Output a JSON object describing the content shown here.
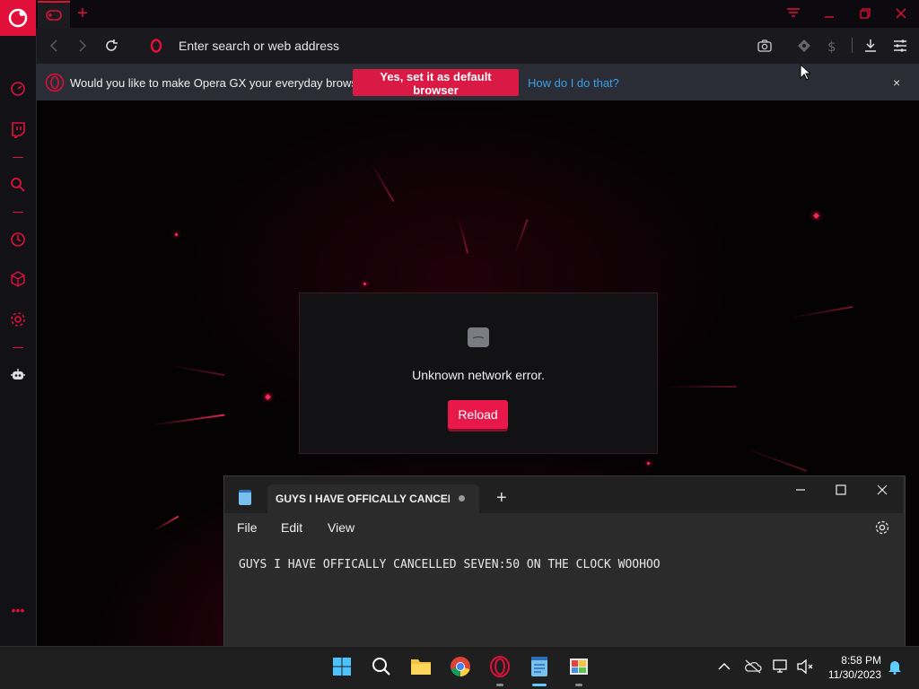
{
  "browser": {
    "address_placeholder": "Enter search or web address"
  },
  "default_bar": {
    "question": "Would you like to make Opera GX your everyday browser?",
    "yes_button": "Yes, set it as default browser",
    "how_link": "How do I do that?",
    "close": "×"
  },
  "error": {
    "message": "Unknown network error.",
    "reload_button": "Reload"
  },
  "notepad": {
    "tab_title": "GUYS I HAVE OFFICALLY CANCELLE",
    "new_tab": "+",
    "menu": [
      "File",
      "Edit",
      "View"
    ],
    "content": "GUYS I HAVE OFFICALLY CANCELLED SEVEN:50 ON THE CLOCK WOOHOO",
    "win_minimize": "—",
    "win_close": "✕"
  },
  "taskbar": {
    "time": "8:58 PM",
    "date": "11/30/2023"
  },
  "colors": {
    "accent": "#e0103a",
    "reload": "#e8194a",
    "link": "#3aa0e8"
  }
}
